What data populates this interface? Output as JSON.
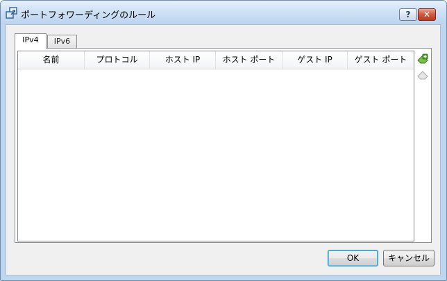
{
  "window": {
    "title": "ポートフォワーディングのルール",
    "help_label": "?",
    "close_label": "✕"
  },
  "tabs": [
    {
      "label": "IPv4",
      "active": true
    },
    {
      "label": "IPv6",
      "active": false
    }
  ],
  "table": {
    "columns": [
      "名前",
      "プロトコル",
      "ホスト IP",
      "ホスト ポート",
      "ゲスト IP",
      "ゲスト ポート"
    ],
    "rows": []
  },
  "side_buttons": {
    "add": "add-rule-icon",
    "remove": "remove-rule-icon"
  },
  "buttons": {
    "ok_label": "OK",
    "cancel_label": "キャンセル"
  }
}
